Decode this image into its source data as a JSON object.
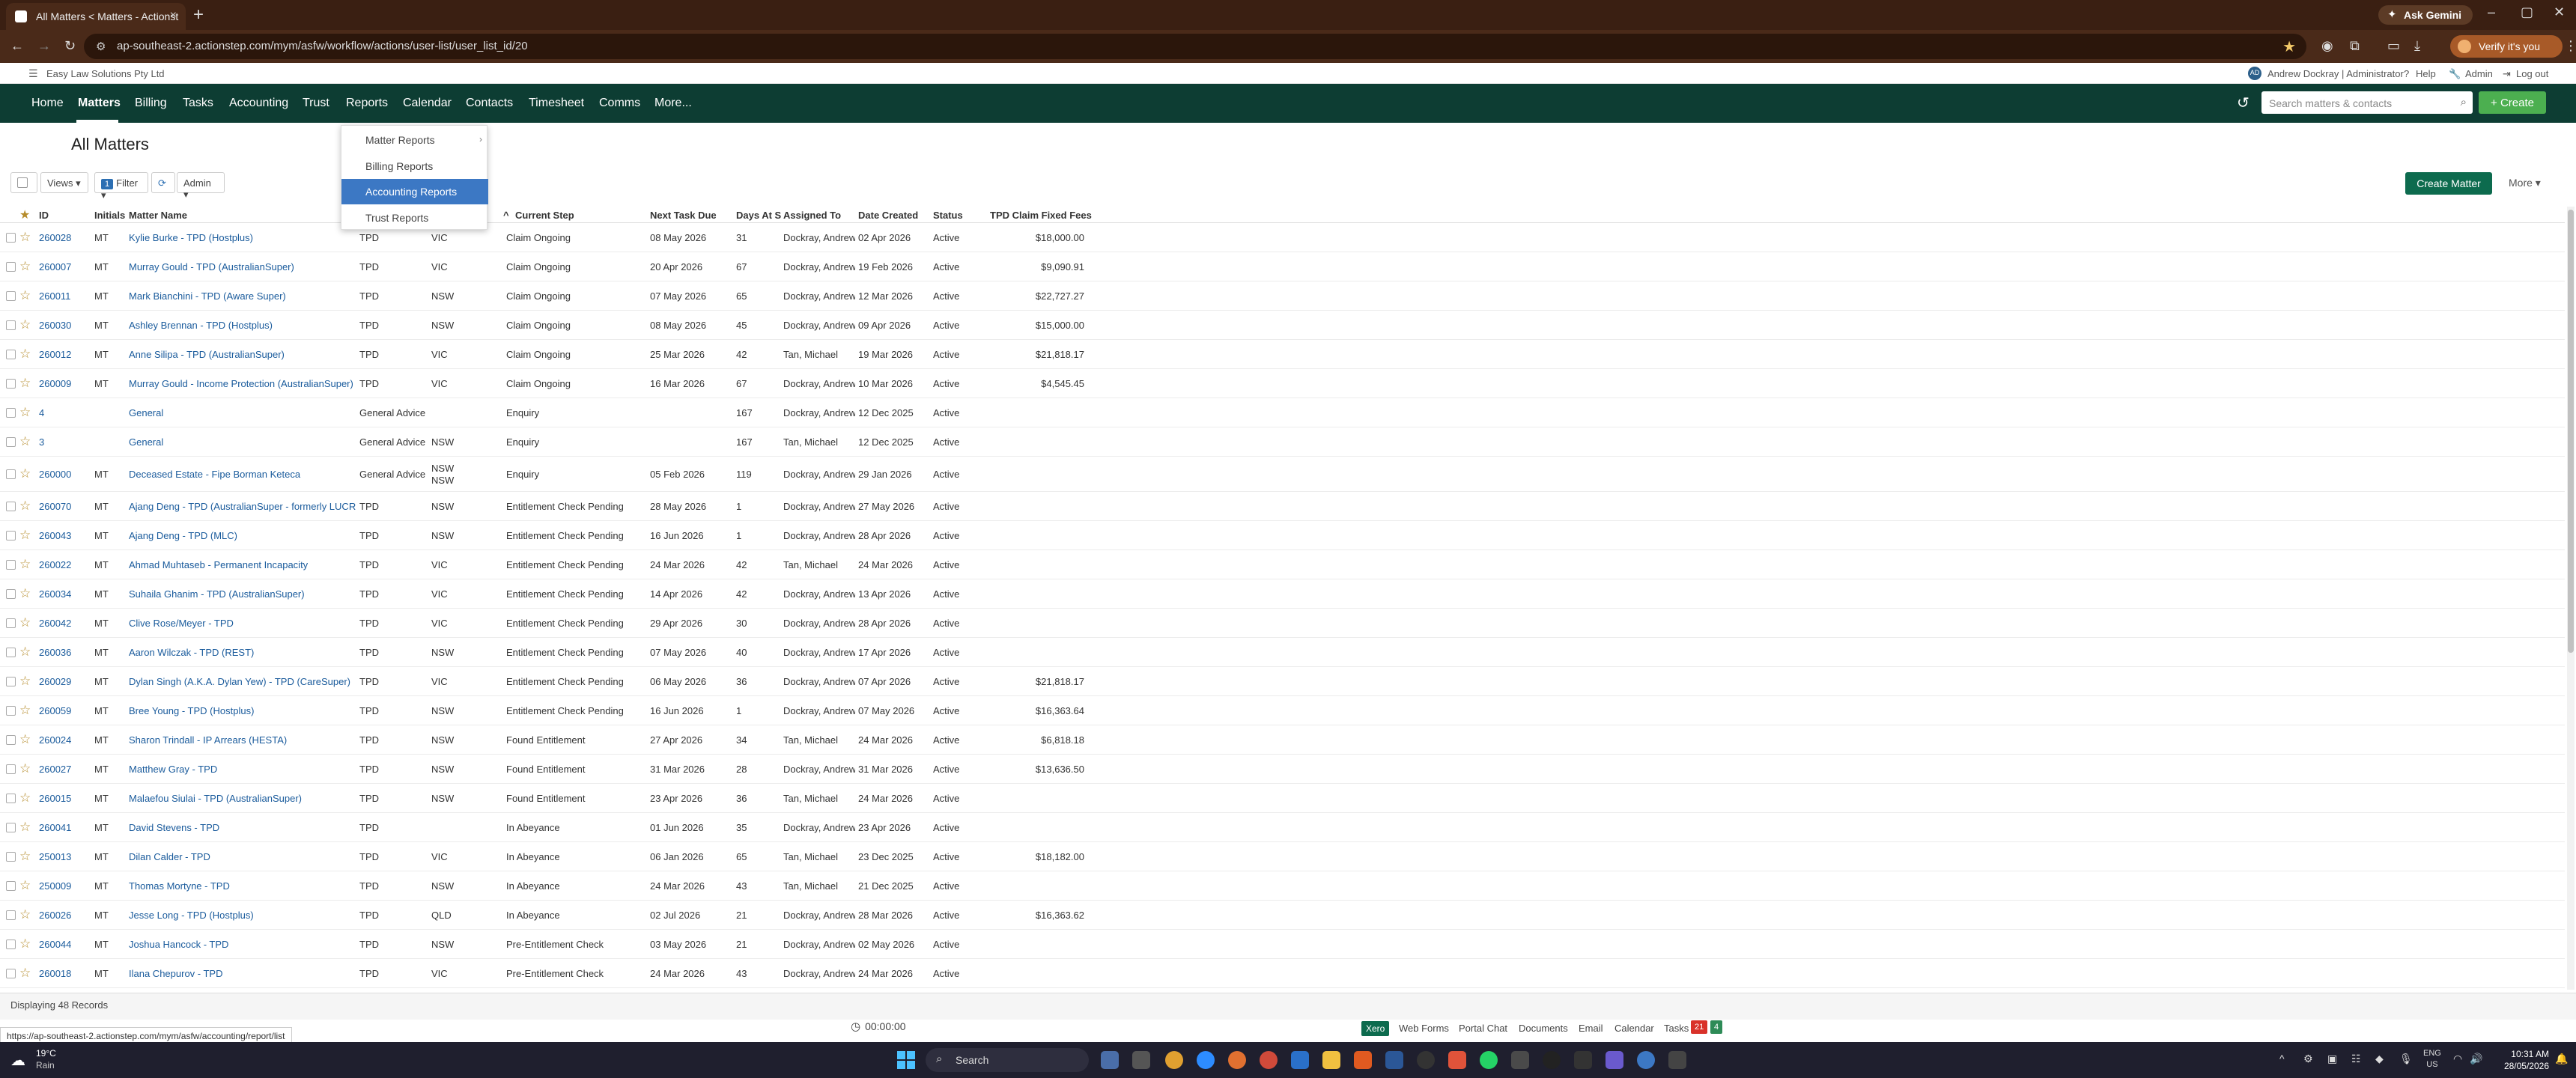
{
  "browser": {
    "tab_title": "All Matters < Matters - Actionst",
    "ask_gemini": "Ask Gemini",
    "url": "ap-southeast-2.actionstep.com/mym/asfw/workflow/actions/user-list/user_list_id/20",
    "verify_label": "Verify it's you"
  },
  "utility": {
    "firm": "Easy Law Solutions Pty Ltd",
    "user_initials": "AD",
    "user": "Andrew Dockray | Administrator",
    "help": "Help",
    "admin": "Admin",
    "logout": "Log out"
  },
  "nav": {
    "items": [
      "Home",
      "Matters",
      "Billing",
      "Tasks",
      "Accounting",
      "Trust",
      "Reports",
      "Calendar",
      "Contacts",
      "Timesheet",
      "Comms",
      "More..."
    ],
    "search_placeholder": "Search matters & contacts",
    "create": "+ Create"
  },
  "page": {
    "title": "All Matters",
    "create_matter": "Create Matter",
    "more": "More"
  },
  "toolbar": {
    "views": "Views",
    "filter_count": "1",
    "filter": "Filter",
    "admin": "Admin"
  },
  "reports_menu": {
    "items": [
      "Matter Reports",
      "Billing Reports",
      "Accounting Reports",
      "Trust Reports"
    ],
    "active_index": 2
  },
  "table": {
    "headers": [
      "ID",
      "Initials",
      "Matter Name",
      "Current Step",
      "Next Task Due",
      "Days At S",
      "Assigned To",
      "Date Created",
      "Status",
      "TPD Claim Fixed Fees"
    ],
    "rows": [
      {
        "id": "260028",
        "ini": "MT",
        "name": "Kylie Burke - TPD (Hostplus)",
        "type": "TPD",
        "state": "VIC",
        "step": "Claim Ongoing",
        "due": "08 May 2026",
        "days": "31",
        "assigned": "Dockray, Andrew",
        "created": "02 Apr 2026",
        "status": "Active",
        "fee": "$18,000.00"
      },
      {
        "id": "260007",
        "ini": "MT",
        "name": "Murray Gould - TPD (AustralianSuper)",
        "type": "TPD",
        "state": "VIC",
        "step": "Claim Ongoing",
        "due": "20 Apr 2026",
        "days": "67",
        "assigned": "Dockray, Andrew",
        "created": "19 Feb 2026",
        "status": "Active",
        "fee": "$9,090.91"
      },
      {
        "id": "260011",
        "ini": "MT",
        "name": "Mark Bianchini - TPD (Aware Super)",
        "type": "TPD",
        "state": "NSW",
        "step": "Claim Ongoing",
        "due": "07 May 2026",
        "days": "65",
        "assigned": "Dockray, Andrew",
        "created": "12 Mar 2026",
        "status": "Active",
        "fee": "$22,727.27"
      },
      {
        "id": "260030",
        "ini": "MT",
        "name": "Ashley Brennan - TPD (Hostplus)",
        "type": "TPD",
        "state": "NSW",
        "step": "Claim Ongoing",
        "due": "08 May 2026",
        "days": "45",
        "assigned": "Dockray, Andrew",
        "created": "09 Apr 2026",
        "status": "Active",
        "fee": "$15,000.00"
      },
      {
        "id": "260012",
        "ini": "MT",
        "name": "Anne Silipa - TPD (AustralianSuper)",
        "type": "TPD",
        "state": "VIC",
        "step": "Claim Ongoing",
        "due": "25 Mar 2026",
        "days": "42",
        "assigned": "Tan, Michael",
        "created": "19 Mar 2026",
        "status": "Active",
        "fee": "$21,818.17"
      },
      {
        "id": "260009",
        "ini": "MT",
        "name": "Murray Gould - Income Protection (AustralianSuper)",
        "type": "TPD",
        "state": "VIC",
        "step": "Claim Ongoing",
        "due": "16 Mar 2026",
        "days": "67",
        "assigned": "Dockray, Andrew",
        "created": "10 Mar 2026",
        "status": "Active",
        "fee": "$4,545.45"
      },
      {
        "id": "4",
        "ini": "",
        "name": "General",
        "type": "General Advice",
        "state": "",
        "step": "Enquiry",
        "due": "",
        "days": "167",
        "assigned": "Dockray, Andrew",
        "created": "12 Dec 2025",
        "status": "Active",
        "fee": ""
      },
      {
        "id": "3",
        "ini": "",
        "name": "General",
        "type": "General Advice",
        "state": "NSW",
        "step": "Enquiry",
        "due": "",
        "days": "167",
        "assigned": "Tan, Michael",
        "created": "12 Dec 2025",
        "status": "Active",
        "fee": ""
      },
      {
        "id": "260000",
        "ini": "MT",
        "name": "Deceased Estate - Fipe Borman Keteca",
        "type": "General Advice",
        "state": "NSW NSW",
        "step": "Enquiry",
        "due": "05 Feb 2026",
        "days": "119",
        "assigned": "Dockray, Andrew",
        "created": "29 Jan 2026",
        "status": "Active",
        "fee": ""
      },
      {
        "id": "260070",
        "ini": "MT",
        "name": "Ajang Deng - TPD (AustralianSuper - formerly LUCRF)",
        "type": "TPD",
        "state": "NSW",
        "step": "Entitlement Check Pending",
        "due": "28 May 2026",
        "days": "1",
        "assigned": "Dockray, Andrew",
        "created": "27 May 2026",
        "status": "Active",
        "fee": ""
      },
      {
        "id": "260043",
        "ini": "MT",
        "name": "Ajang Deng - TPD (MLC)",
        "type": "TPD",
        "state": "NSW",
        "step": "Entitlement Check Pending",
        "due": "16 Jun 2026",
        "days": "1",
        "assigned": "Dockray, Andrew",
        "created": "28 Apr 2026",
        "status": "Active",
        "fee": ""
      },
      {
        "id": "260022",
        "ini": "MT",
        "name": "Ahmad Muhtaseb - Permanent Incapacity",
        "type": "TPD",
        "state": "VIC",
        "step": "Entitlement Check Pending",
        "due": "24 Mar 2026",
        "days": "42",
        "assigned": "Tan, Michael",
        "created": "24 Mar 2026",
        "status": "Active",
        "fee": ""
      },
      {
        "id": "260034",
        "ini": "MT",
        "name": "Suhaila Ghanim - TPD (AustralianSuper)",
        "type": "TPD",
        "state": "VIC",
        "step": "Entitlement Check Pending",
        "due": "14 Apr 2026",
        "days": "42",
        "assigned": "Dockray, Andrew",
        "created": "13 Apr 2026",
        "status": "Active",
        "fee": ""
      },
      {
        "id": "260042",
        "ini": "MT",
        "name": "Clive Rose/Meyer - TPD",
        "type": "TPD",
        "state": "VIC",
        "step": "Entitlement Check Pending",
        "due": "29 Apr 2026",
        "days": "30",
        "assigned": "Dockray, Andrew",
        "created": "28 Apr 2026",
        "status": "Active",
        "fee": ""
      },
      {
        "id": "260036",
        "ini": "MT",
        "name": "Aaron Wilczak - TPD (REST)",
        "type": "TPD",
        "state": "NSW",
        "step": "Entitlement Check Pending",
        "due": "07 May 2026",
        "days": "40",
        "assigned": "Dockray, Andrew",
        "created": "17 Apr 2026",
        "status": "Active",
        "fee": ""
      },
      {
        "id": "260029",
        "ini": "MT",
        "name": "Dylan Singh (A.K.A. Dylan Yew) - TPD (CareSuper)",
        "type": "TPD",
        "state": "VIC",
        "step": "Entitlement Check Pending",
        "due": "06 May 2026",
        "days": "36",
        "assigned": "Dockray, Andrew",
        "created": "07 Apr 2026",
        "status": "Active",
        "fee": "$21,818.17"
      },
      {
        "id": "260059",
        "ini": "MT",
        "name": "Bree Young - TPD (Hostplus)",
        "type": "TPD",
        "state": "NSW",
        "step": "Entitlement Check Pending",
        "due": "16 Jun 2026",
        "days": "1",
        "assigned": "Dockray, Andrew",
        "created": "07 May 2026",
        "status": "Active",
        "fee": "$16,363.64"
      },
      {
        "id": "260024",
        "ini": "MT",
        "name": "Sharon Trindall - IP Arrears (HESTA)",
        "type": "TPD",
        "state": "NSW",
        "step": "Found Entitlement",
        "due": "27 Apr 2026",
        "days": "34",
        "assigned": "Tan, Michael",
        "created": "24 Mar 2026",
        "status": "Active",
        "fee": "$6,818.18"
      },
      {
        "id": "260027",
        "ini": "MT",
        "name": "Matthew Gray - TPD",
        "type": "TPD",
        "state": "NSW",
        "step": "Found Entitlement",
        "due": "31 Mar 2026",
        "days": "28",
        "assigned": "Dockray, Andrew",
        "created": "31 Mar 2026",
        "status": "Active",
        "fee": "$13,636.50"
      },
      {
        "id": "260015",
        "ini": "MT",
        "name": "Malaefou Siulai - TPD (AustralianSuper)",
        "type": "TPD",
        "state": "NSW",
        "step": "Found Entitlement",
        "due": "23 Apr 2026",
        "days": "36",
        "assigned": "Tan, Michael",
        "created": "24 Mar 2026",
        "status": "Active",
        "fee": ""
      },
      {
        "id": "260041",
        "ini": "MT",
        "name": "David Stevens - TPD",
        "type": "TPD",
        "state": "",
        "step": "In Abeyance",
        "due": "01 Jun 2026",
        "days": "35",
        "assigned": "Dockray, Andrew",
        "created": "23 Apr 2026",
        "status": "Active",
        "fee": ""
      },
      {
        "id": "250013",
        "ini": "MT",
        "name": "Dilan Calder - TPD",
        "type": "TPD",
        "state": "VIC",
        "step": "In Abeyance",
        "due": "06 Jan 2026",
        "days": "65",
        "assigned": "Tan, Michael",
        "created": "23 Dec 2025",
        "status": "Active",
        "fee": "$18,182.00"
      },
      {
        "id": "250009",
        "ini": "MT",
        "name": "Thomas Mortyne - TPD",
        "type": "TPD",
        "state": "NSW",
        "step": "In Abeyance",
        "due": "24 Mar 2026",
        "days": "43",
        "assigned": "Tan, Michael",
        "created": "21 Dec 2025",
        "status": "Active",
        "fee": ""
      },
      {
        "id": "260026",
        "ini": "MT",
        "name": "Jesse Long - TPD (Hostplus)",
        "type": "TPD",
        "state": "QLD",
        "step": "In Abeyance",
        "due": "02 Jul 2026",
        "days": "21",
        "assigned": "Dockray, Andrew",
        "created": "28 Mar 2026",
        "status": "Active",
        "fee": "$16,363.62"
      },
      {
        "id": "260044",
        "ini": "MT",
        "name": "Joshua Hancock - TPD",
        "type": "TPD",
        "state": "NSW",
        "step": "Pre-Entitlement Check",
        "due": "03 May 2026",
        "days": "21",
        "assigned": "Dockray, Andrew",
        "created": "02 May 2026",
        "status": "Active",
        "fee": ""
      },
      {
        "id": "260018",
        "ini": "MT",
        "name": "Ilana Chepurov - TPD",
        "type": "TPD",
        "state": "VIC",
        "step": "Pre-Entitlement Check",
        "due": "24 Mar 2026",
        "days": "43",
        "assigned": "Dockray, Andrew",
        "created": "24 Mar 2026",
        "status": "Active",
        "fee": ""
      }
    ]
  },
  "footer": {
    "displaying": "Displaying 48 Records",
    "status_url": "https://ap-southeast-2.actionstep.com/mym/asfw/accounting/report/list",
    "timer": "00:00:00",
    "xero": "Xero",
    "links": [
      "Web Forms",
      "Portal Chat",
      "Documents",
      "Email",
      "Calendar",
      "Tasks"
    ],
    "tasks_red": "21",
    "tasks_green": "4"
  },
  "taskbar": {
    "temp": "19°C",
    "weather": "Rain",
    "search": "Search",
    "lang1": "ENG",
    "lang2": "US",
    "time": "10:31 AM",
    "date": "28/05/2026"
  },
  "colors": {
    "nav_bg": "#0d3d33",
    "create_green": "#4caf50",
    "link_blue": "#1a5b9c",
    "menu_active": "#3c78c4"
  }
}
